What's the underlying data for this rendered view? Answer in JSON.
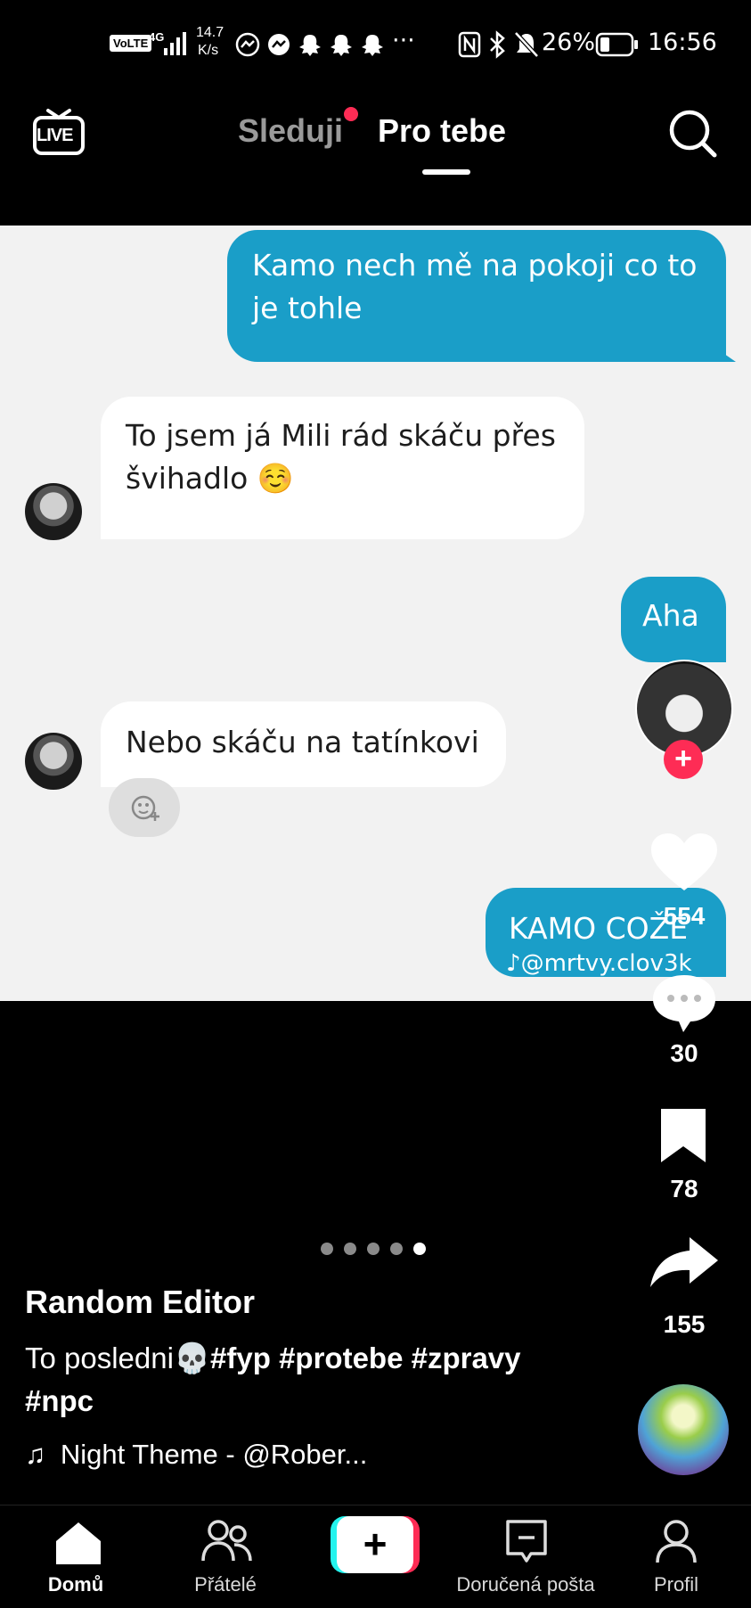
{
  "status_bar": {
    "volte": "VoLTE",
    "network": "4G",
    "speed_value": "14.7",
    "speed_unit": "K/s",
    "battery": "26%",
    "time": "16:56",
    "icons": [
      "signal-icon",
      "messenger-icon",
      "messenger-icon",
      "snapchat-icon",
      "snapchat-icon",
      "snapchat-icon",
      "more-icon",
      "nfc-icon",
      "bluetooth-icon",
      "mute-icon",
      "battery-icon"
    ]
  },
  "header": {
    "live_label": "LIVE",
    "tabs": [
      {
        "label": "Sleduji",
        "active": false,
        "has_dot": true
      },
      {
        "label": "Pro tebe",
        "active": true
      }
    ]
  },
  "chat": {
    "messages": [
      {
        "side": "sent",
        "text": "Kamo nech mě na pokoji co to je tohle"
      },
      {
        "side": "recv",
        "text": "To jsem já Mili rád skáču přes švihadlo ☺️"
      },
      {
        "side": "sent",
        "text": "Aha"
      },
      {
        "side": "recv",
        "text": "Nebo skáču na tatínkovi"
      },
      {
        "side": "sent",
        "text": "KAMO COŽE"
      }
    ],
    "watermark": "@mrtvy.clov3k"
  },
  "rail": {
    "likes": "554",
    "comments": "30",
    "bookmarks": "78",
    "shares": "155"
  },
  "carousel": {
    "count": 5,
    "active_index": 4
  },
  "post": {
    "author": "Random Editor",
    "caption_plain": "To posledni💀",
    "hashtags_line1": "#fyp #protebe #zpravy",
    "hashtags_line2": "#npc",
    "music": "Night Theme - @Rober..."
  },
  "nav": {
    "items": [
      {
        "label": "Domů",
        "active": true
      },
      {
        "label": "Přátelé"
      },
      {
        "label": "Doručená pošta"
      },
      {
        "label": "Profil"
      }
    ]
  },
  "colors": {
    "sent_bubble": "#1a9ec8",
    "accent_red": "#fe2c55",
    "accent_cyan": "#25f4ee"
  }
}
